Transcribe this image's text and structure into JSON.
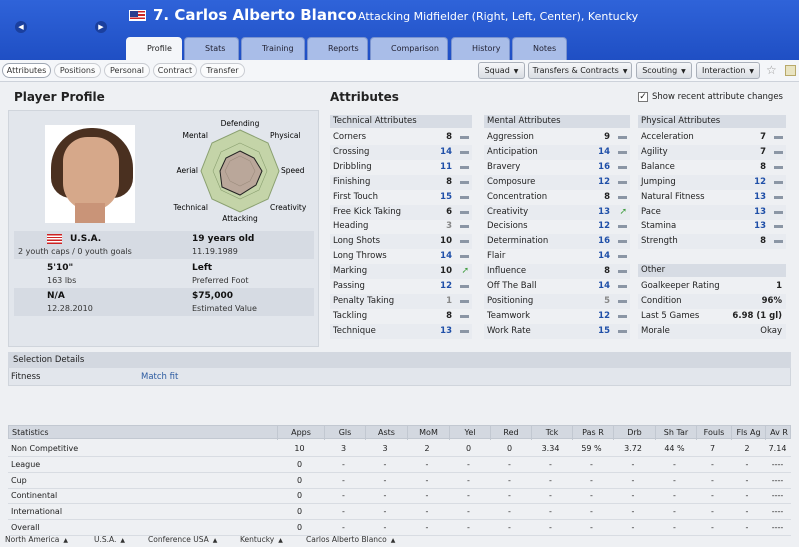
{
  "header": {
    "number_name": "7. Carlos Alberto Blanco",
    "position": "Attacking Midfielder (Right, Left, Center), Kentucky"
  },
  "tabs": [
    "Profile",
    "Stats",
    "Training",
    "Reports",
    "Comparison",
    "History",
    "Notes"
  ],
  "subtabs": [
    "Attributes",
    "Positions",
    "Personal",
    "Contract",
    "Transfer"
  ],
  "dropdowns": [
    "Squad",
    "Transfers & Contracts",
    "Scouting",
    "Interaction"
  ],
  "profile": {
    "title": "Player Profile",
    "radar_labels": [
      "Defending",
      "Physical",
      "Speed",
      "Creativity",
      "Attacking",
      "Technical",
      "Aerial",
      "Mental"
    ],
    "nation": "U.S.A.",
    "caps": "2 youth caps / 0 youth goals",
    "age": "19 years old",
    "dob": "11.19.1989",
    "height": "5'10\"",
    "weight": "163 lbs",
    "foot": "Left",
    "foot_label": "Preferred Foot",
    "contract": "N/A",
    "date": "12.28.2010",
    "value": "$75,000",
    "value_label": "Estimated Value"
  },
  "attributes": {
    "title": "Attributes",
    "show_recent": "Show recent attribute changes",
    "technical": {
      "title": "Technical Attributes",
      "items": [
        [
          "Corners",
          "8"
        ],
        [
          "Crossing",
          "14"
        ],
        [
          "Dribbling",
          "11"
        ],
        [
          "Finishing",
          "8"
        ],
        [
          "First Touch",
          "15"
        ],
        [
          "Free Kick Taking",
          "6"
        ],
        [
          "Heading",
          "3"
        ],
        [
          "Long Shots",
          "10"
        ],
        [
          "Long Throws",
          "14"
        ],
        [
          "Marking",
          "10"
        ],
        [
          "Passing",
          "12"
        ],
        [
          "Penalty Taking",
          "1"
        ],
        [
          "Tackling",
          "8"
        ],
        [
          "Technique",
          "13"
        ]
      ]
    },
    "mental": {
      "title": "Mental Attributes",
      "items": [
        [
          "Aggression",
          "9"
        ],
        [
          "Anticipation",
          "14"
        ],
        [
          "Bravery",
          "16"
        ],
        [
          "Composure",
          "12"
        ],
        [
          "Concentration",
          "8"
        ],
        [
          "Creativity",
          "13"
        ],
        [
          "Decisions",
          "12"
        ],
        [
          "Determination",
          "16"
        ],
        [
          "Flair",
          "14"
        ],
        [
          "Influence",
          "8"
        ],
        [
          "Off The Ball",
          "14"
        ],
        [
          "Positioning",
          "5"
        ],
        [
          "Teamwork",
          "12"
        ],
        [
          "Work Rate",
          "15"
        ]
      ]
    },
    "physical": {
      "title": "Physical Attributes",
      "items": [
        [
          "Acceleration",
          "7"
        ],
        [
          "Agility",
          "7"
        ],
        [
          "Balance",
          "8"
        ],
        [
          "Jumping",
          "12"
        ],
        [
          "Natural Fitness",
          "13"
        ],
        [
          "Pace",
          "13"
        ],
        [
          "Stamina",
          "13"
        ],
        [
          "Strength",
          "8"
        ]
      ]
    },
    "other": {
      "title": "Other",
      "items": [
        [
          "Goalkeeper Rating",
          "1"
        ],
        [
          "Condition",
          "96%"
        ],
        [
          "Last 5 Games",
          "6.98 (1 gl)"
        ],
        [
          "Morale",
          "Okay"
        ]
      ]
    }
  },
  "selection": {
    "title": "Selection Details",
    "label": "Fitness",
    "value": "Match fit"
  },
  "stats": {
    "headers": [
      "Statistics",
      "Apps",
      "Gls",
      "Asts",
      "MoM",
      "Yel",
      "Red",
      "Tck",
      "Pas R",
      "Drb",
      "Sh Tar",
      "Fouls",
      "Fls Ag",
      "Av R"
    ],
    "rows": [
      [
        "Non Competitive",
        "10",
        "3",
        "3",
        "2",
        "0",
        "0",
        "3.34",
        "59 %",
        "3.72",
        "44 %",
        "7",
        "2",
        "7.14"
      ],
      [
        "League",
        "0",
        "-",
        "-",
        "-",
        "-",
        "-",
        "-",
        "-",
        "-",
        "-",
        "-",
        "-",
        "----"
      ],
      [
        "Cup",
        "0",
        "-",
        "-",
        "-",
        "-",
        "-",
        "-",
        "-",
        "-",
        "-",
        "-",
        "-",
        "----"
      ],
      [
        "Continental",
        "0",
        "-",
        "-",
        "-",
        "-",
        "-",
        "-",
        "-",
        "-",
        "-",
        "-",
        "-",
        "----"
      ],
      [
        "International",
        "0",
        "-",
        "-",
        "-",
        "-",
        "-",
        "-",
        "-",
        "-",
        "-",
        "-",
        "-",
        "----"
      ],
      [
        "Overall",
        "0",
        "-",
        "-",
        "-",
        "-",
        "-",
        "-",
        "-",
        "-",
        "-",
        "-",
        "-",
        "----"
      ]
    ]
  },
  "breadcrumb": [
    "North America",
    "U.S.A.",
    "Conference USA",
    "Kentucky",
    "Carlos Alberto Blanco"
  ]
}
